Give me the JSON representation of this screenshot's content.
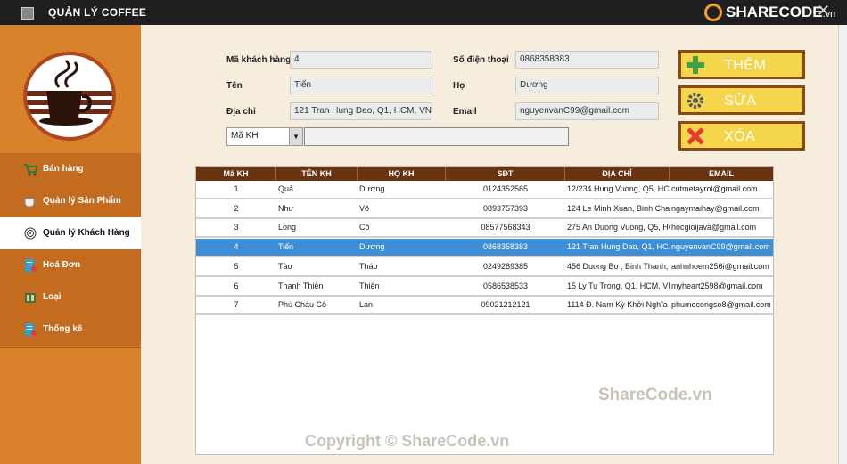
{
  "window": {
    "title": "QUẢN LÝ COFFEE",
    "logo_brand": "SHARECODE",
    "logo_tld": ".vn"
  },
  "sidebar": {
    "items": [
      {
        "label": "Bán hàng",
        "icon": "cart-icon",
        "active": false
      },
      {
        "label": "Quản lý Sản Phẩm",
        "icon": "coffee-cup-icon",
        "active": false
      },
      {
        "label": "Quản lý Khách Hàng",
        "icon": "fingerprint-icon",
        "active": true
      },
      {
        "label": "Hoá Đơn",
        "icon": "invoice-icon",
        "active": false
      },
      {
        "label": "Loại",
        "icon": "category-icon",
        "active": false
      },
      {
        "label": "Thống kê",
        "icon": "report-icon",
        "active": false
      }
    ]
  },
  "form": {
    "ma_kh_label": "Mã khách hàng",
    "ma_kh_value": "4",
    "sdt_label": "Số điện thoại",
    "sdt_value": "0868358383",
    "ten_label": "Tên",
    "ten_value": "Tiến",
    "ho_label": "Họ",
    "ho_value": "Dương",
    "diachi_label": "Địa chỉ",
    "diachi_value": "121 Tran Hung Dao, Q1, HCM, VN",
    "email_label": "Email",
    "email_value": "nguyenvanC99@gmail.com"
  },
  "buttons": {
    "add_label": "THÊM",
    "edit_label": "SỬA",
    "delete_label": "XÓA"
  },
  "search": {
    "combo_value": "Mã KH",
    "query": ""
  },
  "table": {
    "columns": [
      "Mã KH",
      "TÊN KH",
      "HỌ KH",
      "SĐT",
      "ĐỊA CHỈ",
      "EMAIL"
    ],
    "rows": [
      {
        "id": "1",
        "ten": "Quả",
        "ho": "Dương",
        "sdt": "0124352565",
        "diachi": "12/234 Hung Vuong, Q5, HCM...",
        "email": "cutmetayroi@gmail.com"
      },
      {
        "id": "2",
        "ten": "Như",
        "ho": "Võ",
        "sdt": "0893757393",
        "diachi": "124 Le Minh Xuan, Binh Chan...",
        "email": "ngaymaihay@gmail.com"
      },
      {
        "id": "3",
        "ten": "Long",
        "ho": "Cô",
        "sdt": "08577568343",
        "diachi": "275 An Duong Vuong, Q5, HC...",
        "email": "hocgioijava@gmail.com"
      },
      {
        "id": "4",
        "ten": "Tiến",
        "ho": "Dương",
        "sdt": "0868358383",
        "diachi": "121 Tran Hung Dao, Q1, HC...",
        "email": "nguyenvanC99@gmail.com"
      },
      {
        "id": "5",
        "ten": "Tào",
        "ho": "Tháo",
        "sdt": "0249289385",
        "diachi": "456 Duong Bo , Binh Thanh, H...",
        "email": "anhnhoem256i@gmail.com"
      },
      {
        "id": "6",
        "ten": "Thanh Thiên",
        "ho": "Thiên",
        "sdt": "0586538533",
        "diachi": "15 Ly Tu Trong, Q1, HCM, VN",
        "email": "myheart2598@gmail.com"
      },
      {
        "id": "7",
        "ten": "Phú Cháu Cô",
        "ho": "Lan",
        "sdt": "09021212121",
        "diachi": "1114 Đ. Nam Kỳ Khởi Nghĩa",
        "email": "phumecongso8@gmail.com"
      }
    ],
    "selected_index": 3
  },
  "watermarks": {
    "mid": "ShareCode.vn",
    "bottom": "Copyright © ShareCode.vn"
  },
  "colors": {
    "sidebar": "#d9822b",
    "sidebar_item": "#c36c1f",
    "table_header": "#6b3410",
    "selected_row": "#3d8ed6",
    "button_fill": "#f5d54b"
  }
}
